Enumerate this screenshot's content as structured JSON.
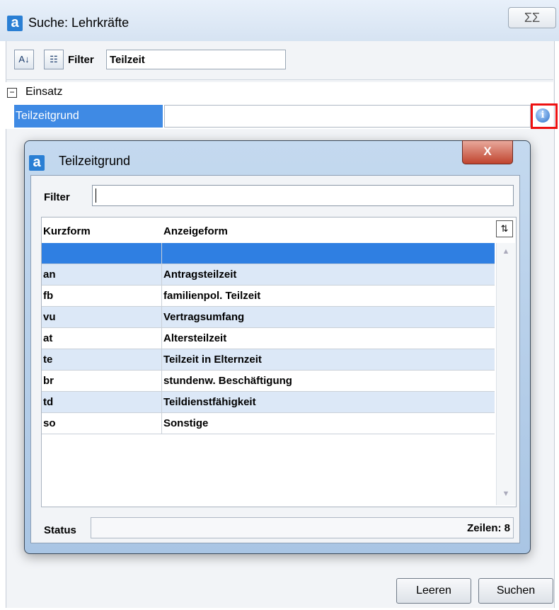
{
  "window": {
    "title": "Suche: Lehrkräfte",
    "close_label": "ΣΣ"
  },
  "toolbar": {
    "filter_label": "Filter",
    "filter_value": "Teilzeit"
  },
  "property_grid": {
    "category": "Einsatz",
    "property_name": "Teilzeitgrund",
    "property_value": ""
  },
  "dialog": {
    "title": "Teilzeitgrund",
    "close_label": "X",
    "filter_label": "Filter",
    "filter_value": "",
    "columns": [
      "Kurzform",
      "Anzeigeform"
    ],
    "rows": [
      [
        "",
        ""
      ],
      [
        "an",
        "Antragsteilzeit"
      ],
      [
        "fb",
        "familienpol. Teilzeit"
      ],
      [
        "vu",
        "Vertragsumfang"
      ],
      [
        "at",
        "Altersteilzeit"
      ],
      [
        "te",
        "Teilzeit in Elternzeit"
      ],
      [
        "br",
        "stundenw. Beschäftigung"
      ],
      [
        "td",
        "Teildienstfähigkeit"
      ],
      [
        "so",
        "Sonstige"
      ]
    ],
    "status_label": "Status",
    "status_rows": "Zeilen: 8"
  },
  "buttons": {
    "clear": "Leeren",
    "search": "Suchen"
  },
  "colors": {
    "selection": "#3f8ae4",
    "alt_row": "#dce8f7",
    "highlight_frame": "#e11111"
  }
}
